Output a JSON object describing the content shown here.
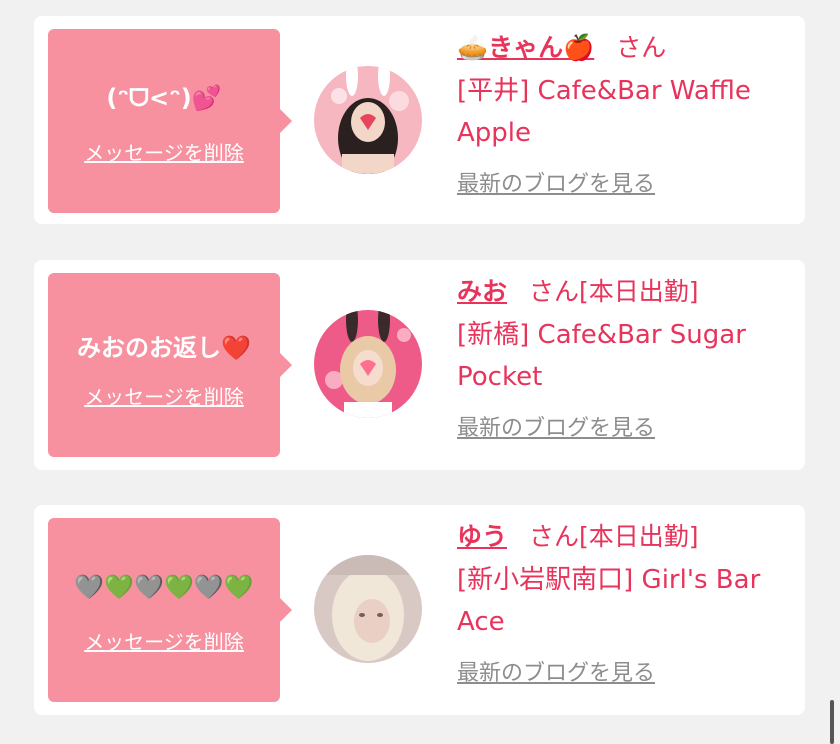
{
  "cards": [
    {
      "message": "(ᵔᗜ<ᵔ)💕",
      "delete_label": "メッセージを削除",
      "name": "🥧きゃん🍎",
      "san_label": "さん",
      "status": "",
      "shop": "[平井] Cafe&Bar Waffle Apple",
      "blog_label": "最新のブログを見る",
      "avatar_colors": {
        "bg": "#f6b7c0",
        "accent": "#e8445b"
      }
    },
    {
      "message": "みおのお返し❤️",
      "delete_label": "メッセージを削除",
      "name": "みお",
      "san_label": "さん",
      "status": "[本日出勤]",
      "shop": "[新橋] Cafe&Bar Sugar Pocket",
      "blog_label": "最新のブログを見る",
      "avatar_colors": {
        "bg": "#ef5b88",
        "accent": "#ffd0dc"
      }
    },
    {
      "message": "🩶💚🩶💚🩶💚",
      "delete_label": "メッセージを削除",
      "name": "ゆう",
      "san_label": "さん",
      "status": "[本日出勤]",
      "shop": "[新小岩駅南口] Girl's Bar Ace",
      "blog_label": "最新のブログを見る",
      "avatar_colors": {
        "bg": "#d9c9c4",
        "accent": "#f0e7d9"
      }
    }
  ],
  "colors": {
    "accent": "#e8335b",
    "bubble": "#f7919f",
    "muted": "#8d8d8d",
    "page_bg": "#f1f1f2"
  }
}
